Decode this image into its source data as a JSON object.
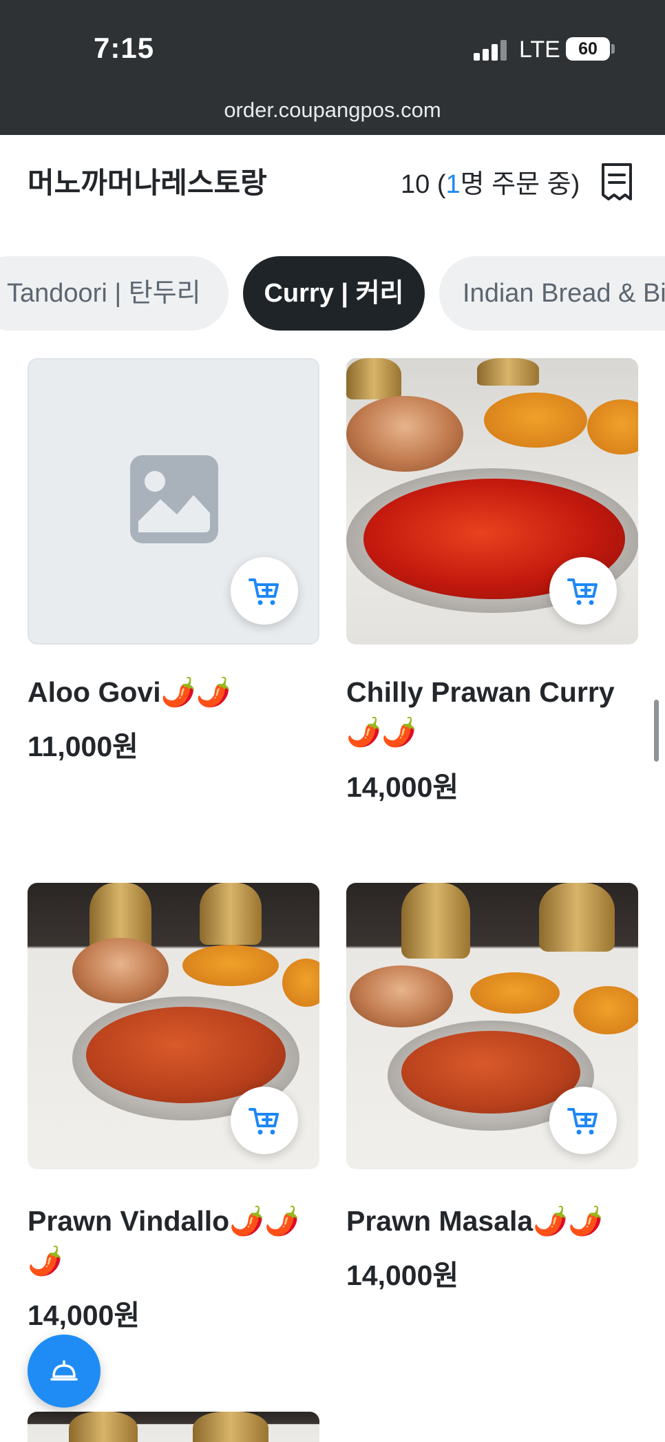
{
  "status_bar": {
    "time": "7:15",
    "network": "LTE",
    "battery": "60"
  },
  "url_bar": {
    "url": "order.coupangpos.com"
  },
  "header": {
    "store_name": "머노까머나레스토랑",
    "order_prefix": "10 (",
    "order_count": "1",
    "order_suffix": "명 주문 중)"
  },
  "tabs": [
    {
      "label": "Tandoori | 탄두리",
      "active": false
    },
    {
      "label": "Curry | 커리",
      "active": true
    },
    {
      "label": "Indian Bread & Biryani",
      "active": false
    }
  ],
  "products": [
    {
      "name": "Aloo Govi🌶️🌶️",
      "price": "11,000원",
      "has_image": false
    },
    {
      "name": "Chilly Prawan Curry🌶️🌶️",
      "price": "14,000원",
      "has_image": true
    },
    {
      "name": "Prawn Vindallo🌶️🌶️🌶️",
      "price": "14,000원",
      "has_image": true
    },
    {
      "name": "Prawn Masala🌶️🌶️",
      "price": "14,000원",
      "has_image": true
    }
  ],
  "colors": {
    "accent": "#1e88f5",
    "active_tab": "#1f2428",
    "status_bar": "#2e3234"
  },
  "icons": {
    "receipt": "receipt-icon",
    "cart": "add-to-cart-icon",
    "fab": "service-bell-icon",
    "placeholder": "image-placeholder-icon"
  }
}
